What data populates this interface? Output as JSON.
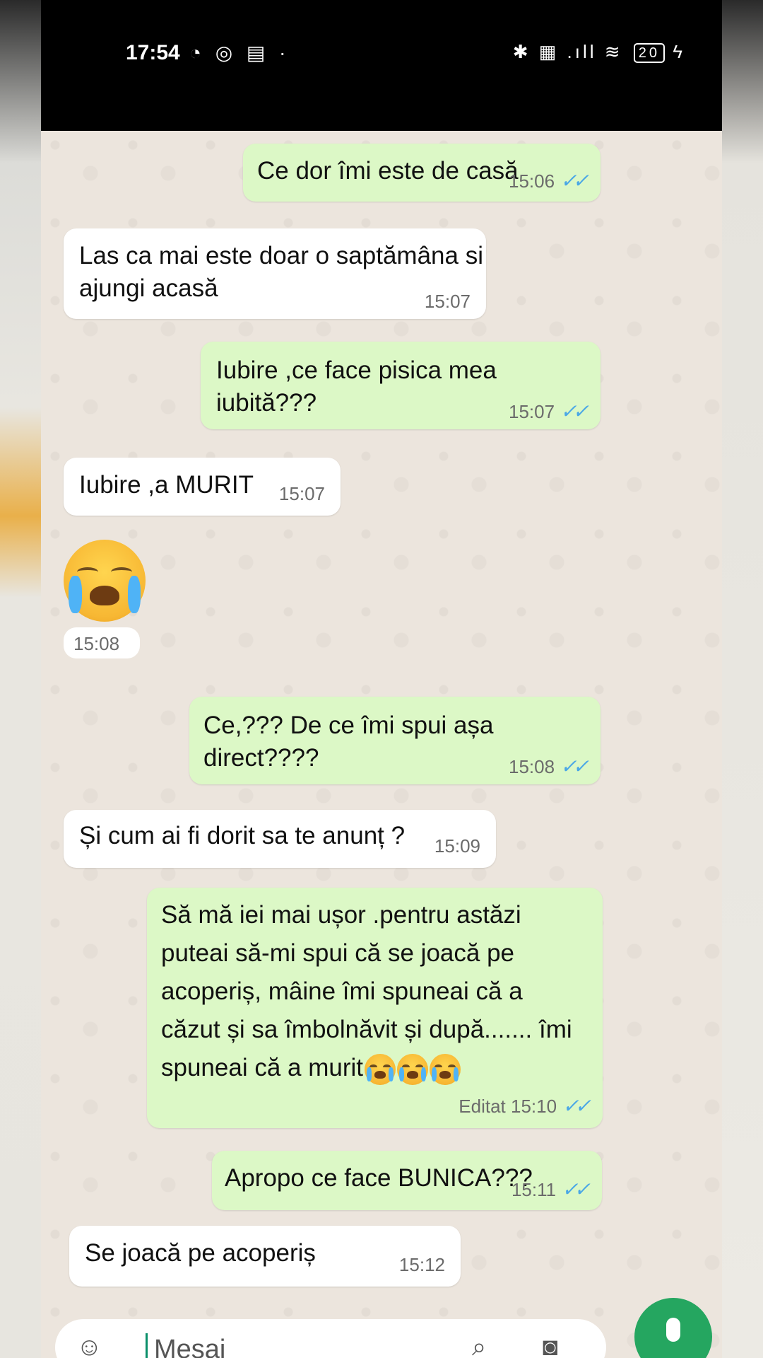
{
  "status_bar": {
    "time": "17:54",
    "left_icons": "◔ ◎ ▤ ·",
    "right_icons": "✱ ▦ .ıll ≋",
    "battery": "20",
    "charging_icon": "ϟ"
  },
  "messages": [
    {
      "dir": "out",
      "text": "Ce dor îmi este de casă",
      "time": "15:06",
      "ticks": "✓✓"
    },
    {
      "dir": "in",
      "lines": [
        "Las ca mai este doar o saptămâna si",
        "ajungi acasă"
      ],
      "time": "15:07"
    },
    {
      "dir": "out",
      "text": "Iubire ,ce face pisica mea iubită???",
      "time": "15:07",
      "ticks": "✓✓"
    },
    {
      "dir": "in",
      "text": "Iubire ,a MURIT",
      "time": "15:07"
    },
    {
      "dir": "in",
      "emoji": "loudly-crying-face",
      "time": "15:08"
    },
    {
      "dir": "out",
      "text": "Ce,??? De ce îmi spui așa direct????",
      "time": "15:08",
      "ticks": "✓✓"
    },
    {
      "dir": "in",
      "text": "Și cum ai fi dorit sa te anunț ?",
      "time": "15:09"
    },
    {
      "dir": "out",
      "lines": [
        "Să mă iei mai ușor .pentru astăzi",
        "puteai să-mi spui că se joacă pe",
        "acoperiș, mâine îmi spuneai că a",
        "căzut și sa îmbolnăvit și după....... îmi",
        "spuneai că a murit"
      ],
      "edited": "Editat",
      "time": "15:10",
      "ticks": "✓✓"
    },
    {
      "dir": "out",
      "text": "Apropo ce face BUNICA???",
      "time": "15:11",
      "ticks": "✓✓"
    },
    {
      "dir": "in",
      "text": "Se joacă pe acoperiș",
      "time": "15:12"
    }
  ],
  "input": {
    "placeholder": "Mesaj",
    "emoji_icon": "☺",
    "attach_icon": "⌕",
    "camera_icon": "◙"
  },
  "colors": {
    "outgoing_bubble": "#dcf8c6",
    "incoming_bubble": "#ffffff",
    "chat_background": "#ece5dd",
    "read_ticks": "#4aa7e6",
    "mic_button": "#25a660"
  }
}
